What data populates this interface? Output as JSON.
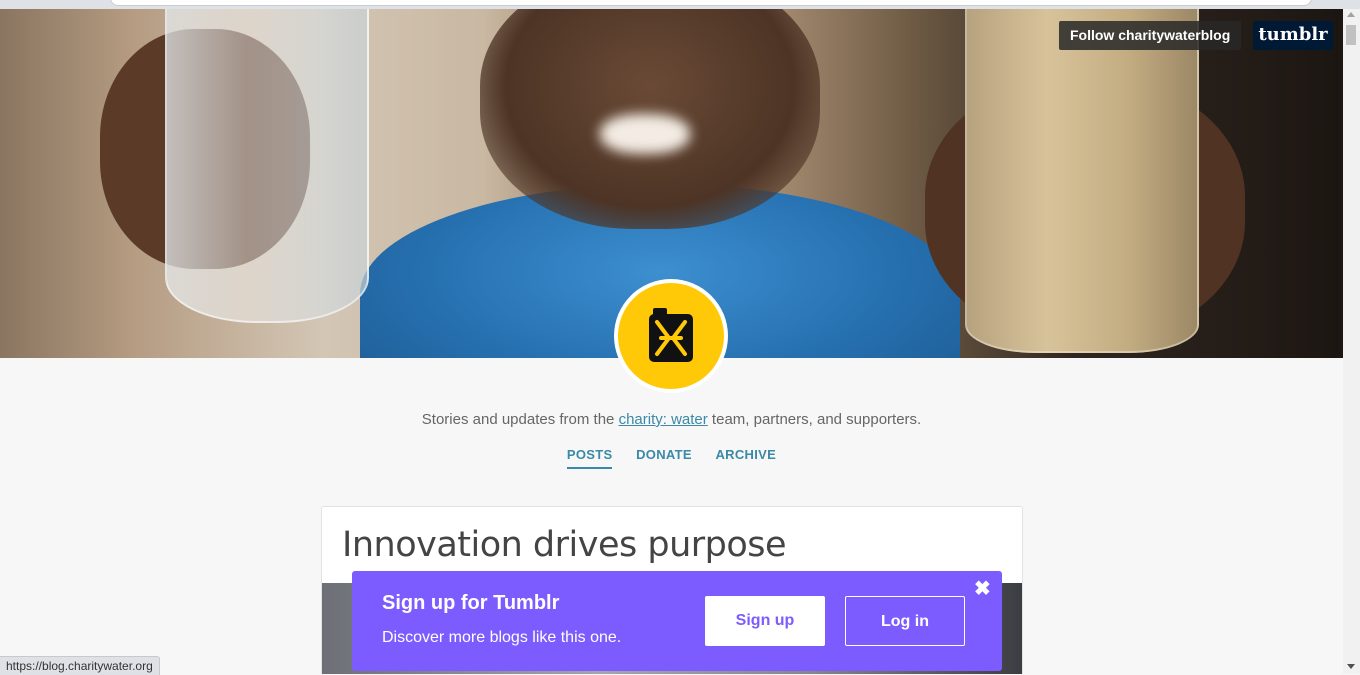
{
  "header": {
    "follow_label": "Follow charitywaterblog",
    "logo_text": "tumblr"
  },
  "blog": {
    "avatar_icon": "jerry-can-icon",
    "description_prefix": "Stories and updates from the ",
    "description_link": "charity: water",
    "description_suffix": " team, partners, and supporters."
  },
  "nav": {
    "items": [
      {
        "label": "POSTS"
      },
      {
        "label": "DONATE"
      },
      {
        "label": "ARCHIVE"
      }
    ]
  },
  "post": {
    "title": "Innovation drives purpose"
  },
  "signup": {
    "title": "Sign up for Tumblr",
    "subtitle": "Discover more blogs like this one.",
    "signup_label": "Sign up",
    "login_label": "Log in",
    "close_icon": "✖"
  },
  "status": {
    "url": "https://blog.charitywater.org"
  },
  "colors": {
    "accent": "#3a89a7",
    "banner": "#7c5cff",
    "avatar_bg": "#ffc907",
    "tumblr_navy": "#001935"
  }
}
